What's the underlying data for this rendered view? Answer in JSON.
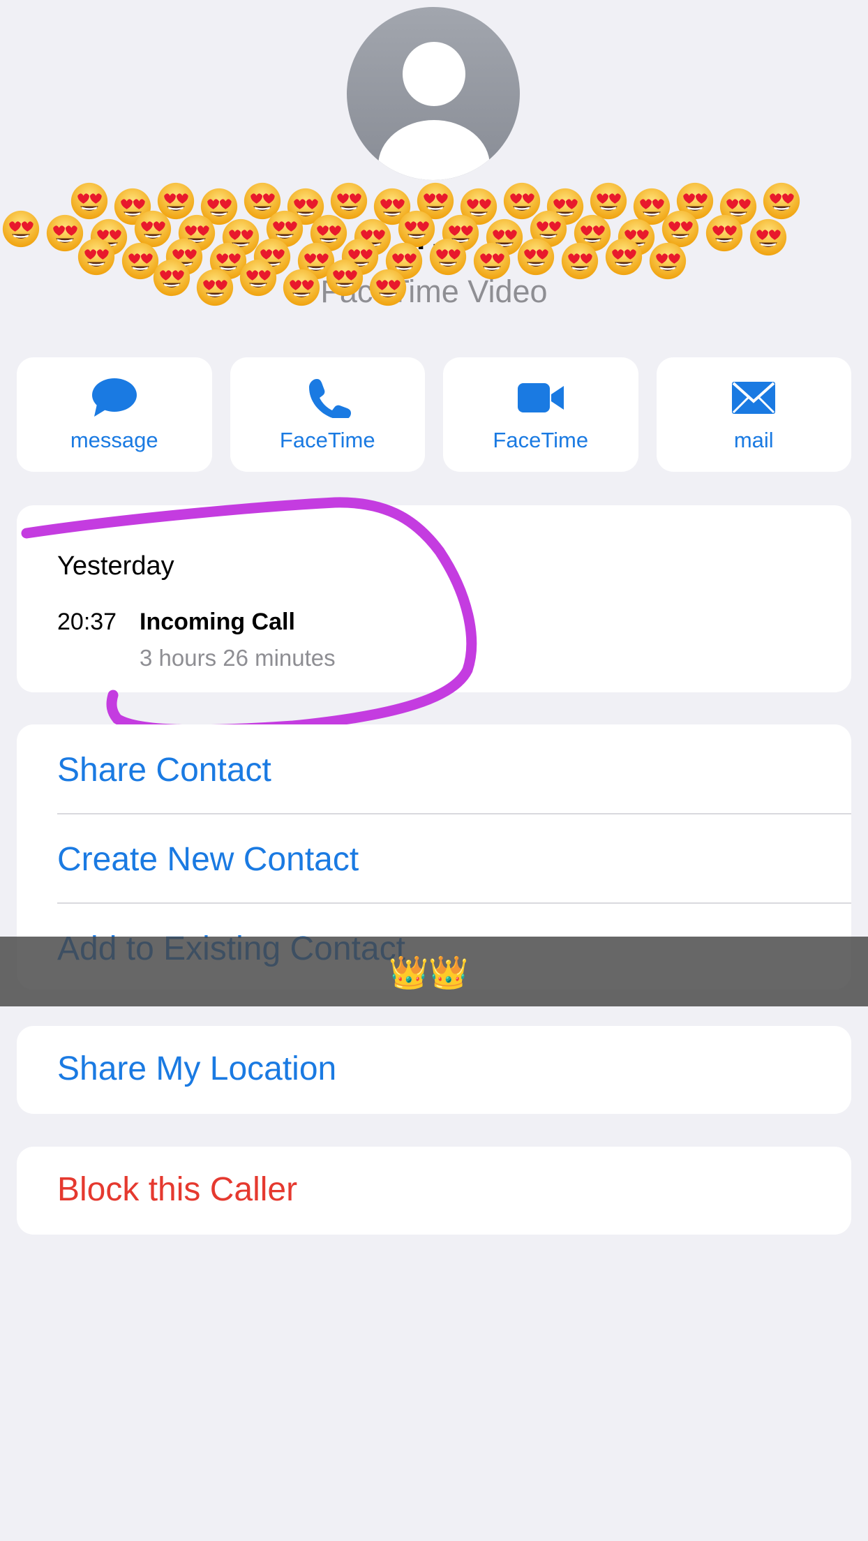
{
  "header": {
    "name": "…n",
    "subtitle": "FaceTime Video"
  },
  "actions": [
    {
      "label": "message",
      "icon": "message-bubble-icon"
    },
    {
      "label": "FaceTime",
      "icon": "phone-icon"
    },
    {
      "label": "FaceTime",
      "icon": "video-camera-icon"
    },
    {
      "label": "mail",
      "icon": "envelope-icon"
    }
  ],
  "recent_call": {
    "day": "Yesterday",
    "time": "20:37",
    "type": "Incoming Call",
    "duration": "3 hours 26 minutes"
  },
  "options": {
    "share_contact": "Share Contact",
    "create_new_contact": "Create New Contact",
    "add_to_existing": "Add to Existing Contact"
  },
  "overlay": {
    "crowns": "👑👑"
  },
  "share_location": "Share My Location",
  "block_caller": "Block this Caller",
  "colors": {
    "accent": "#1a7ae2",
    "destructive": "#e5392f",
    "annotation": "#c43ce0",
    "background": "#f0f0f5"
  }
}
